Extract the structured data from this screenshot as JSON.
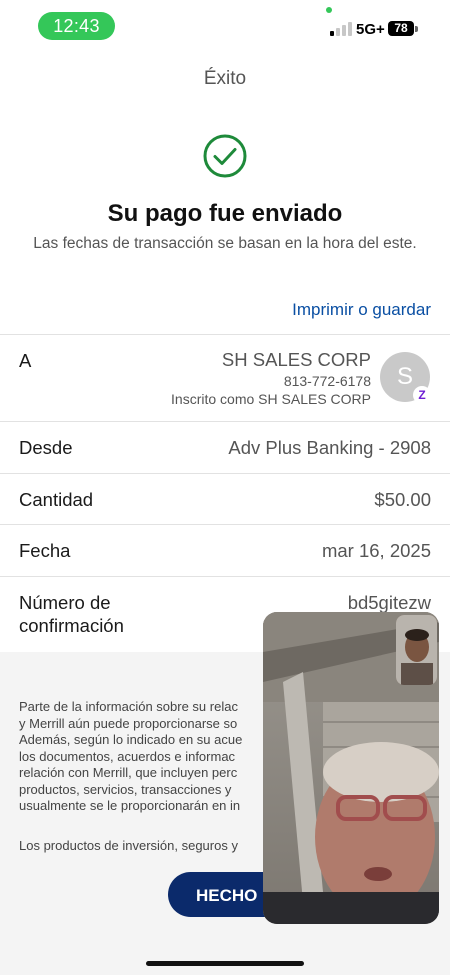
{
  "status_bar": {
    "time": "12:43",
    "network": "5G+",
    "battery": "78",
    "accent_color": "#34c759"
  },
  "header": {
    "title": "Éxito"
  },
  "confirmation": {
    "icon": "check-circle-icon",
    "icon_color": "#1e8a3a",
    "heading": "Su pago fue enviado",
    "subheading": "Las fechas de transacción se basan en la hora del este."
  },
  "print_link": "Imprimir o guardar",
  "details": {
    "to": {
      "label": "A",
      "name": "SH SALES CORP",
      "phone": "813-772-6178",
      "enrolled_as": "Inscrito como SH SALES CORP",
      "avatar_initial": "S",
      "badge": "Z"
    },
    "from": {
      "label": "Desde",
      "value": "Adv Plus Banking - 2908"
    },
    "amount": {
      "label": "Cantidad",
      "value": "$50.00"
    },
    "date": {
      "label": "Fecha",
      "value": "mar 16, 2025"
    },
    "confirmation_number": {
      "label_line1": "Número de",
      "label_line2": "confirmación",
      "value": "bd5gitezw"
    }
  },
  "disclosure": {
    "lines": [
      "Parte de la información sobre su relac",
      "y Merrill aún puede proporcionarse so",
      "Además, según lo indicado en su acue",
      "los documentos, acuerdos e informac",
      "relación con Merrill, que incluyen perc",
      "productos, servicios, transacciones y",
      "usualmente se le proporcionarán en in"
    ],
    "second": "Los productos de inversión, seguros y"
  },
  "done_button": "HECHO",
  "brand_color": "#0b2a6b",
  "link_color": "#0a4fa3"
}
